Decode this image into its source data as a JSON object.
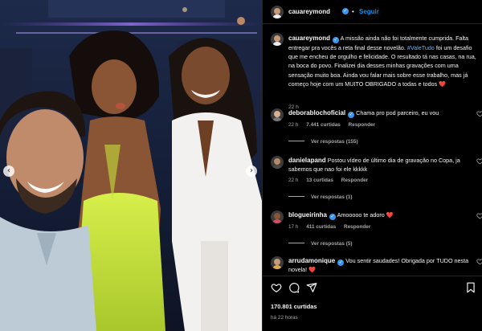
{
  "header": {
    "username": "cauareymond",
    "separator": "•",
    "follow_label": "Seguir"
  },
  "photo": {
    "prev_glyph": "‹",
    "next_glyph": "›"
  },
  "caption": {
    "username": "cauareymond",
    "text_before": "A missão ainda não foi totalmente cumprida. Falta entregar pra vocês a reta final desse novelão.",
    "hashtag": "#ValeTudo",
    "text_after": "foi um desafio que me encheu de orgulho e felicidade. O resultado tá nas casas, na rua, na boca do povo. Finalizei dia desses minhas gravações com uma sensação muito boa. Ainda vou falar mais sobre esse trabalho, mas já começo hoje com um MUITO OBRIGADO a todas e todos",
    "emoji": "❤️",
    "time": "22 h"
  },
  "comments": [
    {
      "username": "deborablochoficial",
      "text": "Chama pro pod parceiro, eu vou",
      "emoji": "",
      "time": "22 h",
      "likes": "7.441 curtidas",
      "reply_label": "Responder",
      "view_replies": "Ver respostas (155)"
    },
    {
      "username": "danielapand",
      "text": "Postou vídeo de último dia de gravação no Copa, ja sabemos que nao foi ele kkkkk",
      "emoji": "",
      "time": "22 h",
      "likes": "13 curtidas",
      "reply_label": "Responder",
      "view_replies": "Ver respostas (1)"
    },
    {
      "username": "blogueirinha",
      "text": "Amooooo te adoro",
      "emoji": "❤️",
      "time": "17 h",
      "likes": "411 curtidas",
      "reply_label": "Responder",
      "view_replies": "Ver respostas (5)"
    },
    {
      "username": "arrudamonique",
      "text": "Vou sentir saudades! Obrigada por TUDO nesta novela!",
      "emoji": "❤️",
      "time": "",
      "likes": "",
      "reply_label": "",
      "view_replies": ""
    }
  ],
  "footer": {
    "likes": "170.801 curtidas",
    "time": "há 22 horas"
  },
  "icons": {
    "like": "heart-icon",
    "comment": "comment-icon",
    "share": "share-icon",
    "verified": "verified-badge-icon",
    "prev": "chevron-left-icon",
    "next": "chevron-right-icon"
  },
  "colors": {
    "background": "#000000",
    "link_blue": "#0095f6",
    "hashtag": "#6ab4f8",
    "heart_red": "#ff3040",
    "muted": "#a8a8a8",
    "divider": "#262626"
  }
}
